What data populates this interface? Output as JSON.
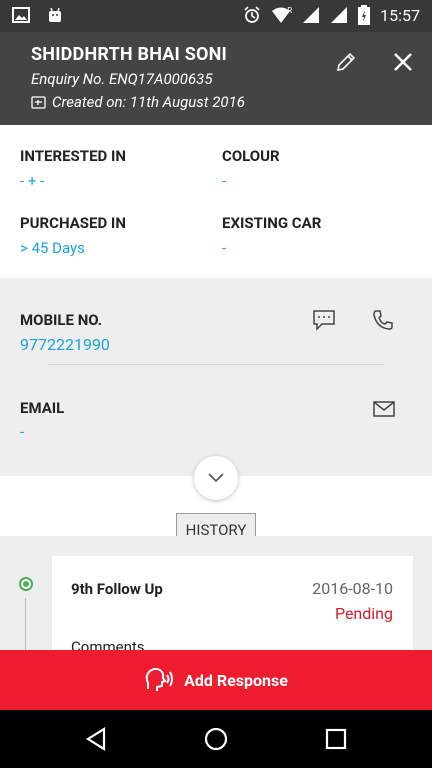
{
  "status_bar": {
    "time": "15:57",
    "left_icons": [
      "image-icon",
      "android-icon"
    ],
    "right_icons": [
      "alarm-icon",
      "wifi-icon",
      "signal-icon",
      "signal-icon",
      "battery-icon"
    ],
    "roaming_badge": "R"
  },
  "header": {
    "customer_name": "SHIDDHRTH BHAI SONI",
    "enquiry_no": "Enquiry No. ENQ17A000635",
    "created_on": "Created on: 11th August 2016",
    "edit_icon": "pencil-icon",
    "close_icon": "close-icon"
  },
  "details": {
    "interested_in_label": "INTERESTED IN",
    "interested_in_value": "- + -",
    "colour_label": "COLOUR",
    "colour_value": "-",
    "purchased_in_label": "PURCHASED IN",
    "purchased_in_value": "> 45 Days",
    "existing_car_label": "EXISTING CAR",
    "existing_car_value": "-"
  },
  "contact": {
    "mobile_label": "MOBILE NO.",
    "mobile_value": "9772221990",
    "email_label": "EMAIL",
    "email_value": "-"
  },
  "history_button": "HISTORY",
  "timeline": [
    {
      "title": "9th Follow Up",
      "date": "2016-08-10",
      "status": "Pending",
      "comments_label": "Comments"
    }
  ],
  "add_response_label": "Add Response",
  "colors": {
    "accent_blue": "#1aa3d9",
    "header_bg": "#444444",
    "action_red": "#ee1c2f",
    "pending_red": "#d3202f",
    "timeline_green": "#4caf50"
  }
}
